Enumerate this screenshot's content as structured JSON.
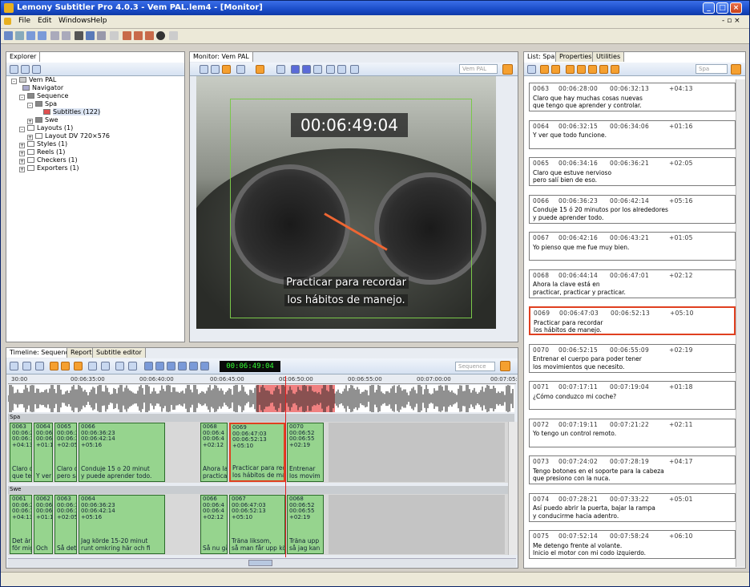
{
  "window": {
    "title": "Lemony Subtitler Pro 4.0.3 - Vem PAL.lem4 - [Monitor]"
  },
  "menu": [
    "File",
    "Edit",
    "Windows",
    "Help"
  ],
  "explorer": {
    "tab": "Explorer",
    "tree": [
      "Vem PAL",
      "Navigator",
      "Sequence",
      "Spa",
      "Subtitles (122)",
      "Swe",
      "Layouts (1)",
      "Layout DV 720×576",
      "Styles (1)",
      "Reels (1)",
      "Checkers (1)",
      "Exporters (1)"
    ]
  },
  "monitor": {
    "tab": "Monitor: Vem PAL",
    "dropdown": "Vem PAL",
    "timecode": "00:06:49:04",
    "subtitle_line1": "Practicar para recordar",
    "subtitle_line2": "los hábitos de manejo."
  },
  "timeline": {
    "tabs": [
      "Timeline: Sequence",
      "Report",
      "Subtitle editor"
    ],
    "timecode": "00:06:49:04",
    "dropdown": "Sequence",
    "ruler": [
      "30:00",
      "00:06:35:00",
      "00:06:40:00",
      "00:06:45:00",
      "00:06:50:00",
      "00:06:55:00",
      "00:07:00:00",
      "00:07:05:"
    ],
    "track_spa": "Spa",
    "track_swe": "Swe",
    "spa_blocks": [
      {
        "l1": "0063",
        "l2": "00:06:28",
        "l3": "00:06:32",
        "l4": "+04:13",
        "t1": "Claro qu",
        "t2": "que teng"
      },
      {
        "l1": "0064",
        "l2": "00:06:",
        "l3": "00:06:",
        "l4": "+01:1",
        "t1": "Y ver",
        "t2": ""
      },
      {
        "l1": "0065",
        "l2": "00:06:3",
        "l3": "00:06:3",
        "l4": "+02:05",
        "t1": "Claro q",
        "t2": "pero sa"
      },
      {
        "l1": "0066",
        "l2": "00:06:36:23",
        "l3": "00:06:42:14",
        "l4": "+05:16",
        "t1": "Conduje 15 o 20 minut",
        "t2": "y puede aprender todo."
      },
      {
        "l1": "0068",
        "l2": "00:06:4",
        "l3": "00:06:4",
        "l4": "+02:12",
        "t1": "Ahora la",
        "t2": "practicar"
      },
      {
        "l1": "0069",
        "l2": "00:06:47:03",
        "l3": "00:06:52:13",
        "l4": "+05:10",
        "t1": "Practicar para recorda",
        "t2": "los hábitos de manejo"
      },
      {
        "l1": "0070",
        "l2": "00:06:52",
        "l3": "00:06:55",
        "l4": "+02:19",
        "t1": "Entrenar",
        "t2": "los movim"
      }
    ],
    "swe_blocks": [
      {
        "l1": "0061",
        "l2": "00:06:28",
        "l3": "00:06:32",
        "l4": "+04:13",
        "t1": "Det är ju",
        "t2": "för mig o"
      },
      {
        "l1": "0062",
        "l2": "00:06",
        "l3": "00:06",
        "l4": "+01:1",
        "t1": "Och",
        "t2": ""
      },
      {
        "l1": "0063",
        "l2": "00:06:3",
        "l3": "00:06:3",
        "l4": "+02:05",
        "t1": "Så det",
        "t2": ""
      },
      {
        "l1": "0064",
        "l2": "00:06:36:23",
        "l3": "00:06:42:14",
        "l4": "+05:16",
        "t1": "Jag körde 15-20 minut",
        "t2": "runt omkring här och fi"
      },
      {
        "l1": "0066",
        "l2": "00:06:4",
        "l3": "00:06:4",
        "l4": "+02:12",
        "t1": "Så nu gå",
        "t2": ""
      },
      {
        "l1": "0067",
        "l2": "00:06:47:03",
        "l3": "00:06:52:13",
        "l4": "+05:10",
        "t1": "Träna liksom,",
        "t2": "så man får upp körvan"
      },
      {
        "l1": "0068",
        "l2": "00:06:52",
        "l3": "00:06:55",
        "l4": "+02:19",
        "t1": "Träna upp",
        "t2": "så jag kan"
      }
    ]
  },
  "list": {
    "tabs": [
      "List: Spa",
      "Properties",
      "Utilities"
    ],
    "dropdown": "Spa",
    "items": [
      {
        "num": "0063",
        "in": "00:06:28:00",
        "out": "00:06:32:13",
        "dur": "+04:13",
        "l1": "Claro que hay muchas cosas nuevas",
        "l2": "que tengo que aprender y controlar."
      },
      {
        "num": "0064",
        "in": "00:06:32:15",
        "out": "00:06:34:06",
        "dur": "+01:16",
        "l1": "Y ver que todo funcione.",
        "l2": ""
      },
      {
        "num": "0065",
        "in": "00:06:34:16",
        "out": "00:06:36:21",
        "dur": "+02:05",
        "l1": "Claro que estuve nervioso",
        "l2": "pero salí bien de eso."
      },
      {
        "num": "0066",
        "in": "00:06:36:23",
        "out": "00:06:42:14",
        "dur": "+05:16",
        "l1": "Conduje 15 ó 20 minutos por los alrededores",
        "l2": "y puede aprender todo."
      },
      {
        "num": "0067",
        "in": "00:06:42:16",
        "out": "00:06:43:21",
        "dur": "+01:05",
        "l1": "Yo pienso que me fue muy bien.",
        "l2": ""
      },
      {
        "num": "0068",
        "in": "00:06:44:14",
        "out": "00:06:47:01",
        "dur": "+02:12",
        "l1": "Ahora la clave está en",
        "l2": "practicar, practicar y practicar."
      },
      {
        "num": "0069",
        "in": "00:06:47:03",
        "out": "00:06:52:13",
        "dur": "+05:10",
        "l1": "Practicar para recordar",
        "l2": "los hábitos de manejo."
      },
      {
        "num": "0070",
        "in": "00:06:52:15",
        "out": "00:06:55:09",
        "dur": "+02:19",
        "l1": "Entrenar el cuerpo para poder tener",
        "l2": "los movimientos que necesito."
      },
      {
        "num": "0071",
        "in": "00:07:17:11",
        "out": "00:07:19:04",
        "dur": "+01:18",
        "l1": "¿Cómo conduzco mi coche?",
        "l2": ""
      },
      {
        "num": "0072",
        "in": "00:07:19:11",
        "out": "00:07:21:22",
        "dur": "+02:11",
        "l1": "Yo tengo un control remoto.",
        "l2": ""
      },
      {
        "num": "0073",
        "in": "00:07:24:02",
        "out": "00:07:28:19",
        "dur": "+04:17",
        "l1": "Tengo botones en el soporte para la cabeza",
        "l2": "que presiono con la nuca."
      },
      {
        "num": "0074",
        "in": "00:07:28:21",
        "out": "00:07:33:22",
        "dur": "+05:01",
        "l1": "Así puedo abrir la puerta, bajar la rampa",
        "l2": "y conducirme hacia adentro."
      },
      {
        "num": "0075",
        "in": "00:07:52:14",
        "out": "00:07:58:24",
        "dur": "+06:10",
        "l1": "Me detengo frente al volante.",
        "l2": "Inicio el motor con mi codo izquierdo."
      }
    ]
  }
}
